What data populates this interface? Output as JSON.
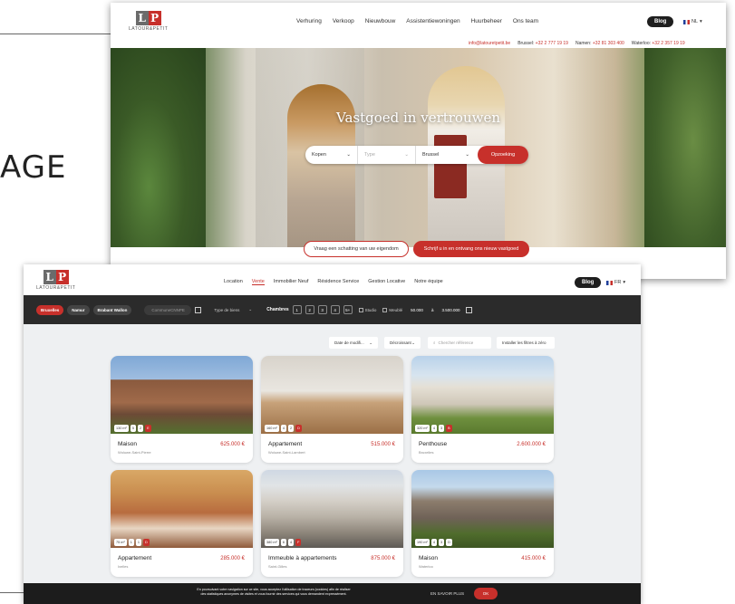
{
  "slide": {
    "heading_fragment": "AGE"
  },
  "shot1": {
    "brand": "LATOUR&PETIT",
    "menu": [
      "Verhuring",
      "Verkoop",
      "Nieuwbouw",
      "Assistentiewoningen",
      "Huurbeheer",
      "Ons team"
    ],
    "blog_label": "Blog",
    "lang": "NL",
    "contact": {
      "email": "info@latouretpetit.be",
      "brussel_label": "Brussel:",
      "brussel_phone": "+32 2 777 19 19",
      "namen_label": "Namen:",
      "namen_phone": "+32 81 303 400",
      "waterloo_label": "Waterloo:",
      "waterloo_phone": "+32 2 357 19 19"
    },
    "hero_title": "Vastgoed in vertrouwen",
    "search": {
      "mode": "Kopen",
      "type_placeholder": "Type",
      "city": "Brussel",
      "button": "Opzoeking"
    },
    "cta_estimate": "Vraag een schatting van uw eigendom",
    "cta_subscribe": "Schrijf u in en ontvang ons nieuw vastgoed"
  },
  "shot2": {
    "brand": "LATOUR&PETIT",
    "menu": [
      "Location",
      "Vente",
      "Immobilier Neuf",
      "Résidence Service",
      "Gestion Locative",
      "Notre équipe"
    ],
    "menu_active_index": 1,
    "blog_label": "Blog",
    "lang": "FR",
    "filters": {
      "cities": [
        "Bruxelles",
        "Namur",
        "Brabant Wallon"
      ],
      "commune_placeholder": "Commune",
      "postcode": "CNNPE",
      "type_placeholder": "Type de biens",
      "rooms_label": "Chambres",
      "rooms": [
        "1",
        "2",
        "3",
        "4",
        "5+"
      ],
      "check_studio": "Studio",
      "check_meuble": "Meublé",
      "price_min": "50.000",
      "price_sep": "à",
      "price_max": "3.500.000"
    },
    "sort": {
      "date_label": "Date de modifi...",
      "order_label": "Décroissant",
      "search_placeholder": "Chercher référence",
      "reset_label": "Installer les filtres à zéro"
    },
    "listings": [
      {
        "type": "Maison",
        "location": "Woluwe-Saint-Pierre",
        "price": "625.000 €",
        "area": "130 m²",
        "beds": "5",
        "baths": "2",
        "peb": "E"
      },
      {
        "type": "Appartement",
        "location": "Woluwe-Saint-Lambert",
        "price": "515.000 €",
        "area": "160 m²",
        "beds": "4",
        "baths": "2",
        "peb": "D"
      },
      {
        "type": "Penthouse",
        "location": "Bruxelles",
        "price": "2.600.000 €",
        "area": "320 m²",
        "beds": "4",
        "baths": "3",
        "peb": "B"
      },
      {
        "type": "Appartement",
        "location": "Ixelles",
        "price": "285.000 €",
        "area": "75 m²",
        "beds": "1",
        "baths": "1",
        "peb": "D"
      },
      {
        "type": "Immeuble à appartements",
        "location": "Saint-Gilles",
        "price": "875.000 €",
        "area": "380 m²",
        "beds": "6",
        "baths": "4",
        "peb": "F"
      },
      {
        "type": "Maison",
        "location": "Waterloo",
        "price": "415.000 €",
        "area": "190 m²",
        "beds": "4",
        "baths": "3",
        "peb": "D"
      }
    ],
    "cookie": {
      "text_line1": "En poursuivant votre navigation sur ce site, vous acceptez l'utilisation de traceurs (cookies) afin de réaliser",
      "text_line2": "des statistiques anonymes de visites et vous fournir des services qui vous demandent expressément.",
      "more_label": "EN SAVOIR PLUS",
      "ok_label": "OK"
    }
  },
  "colors": {
    "accent": "#c7302b",
    "dark": "#2b2b2b",
    "panel": "#eef0f2"
  }
}
